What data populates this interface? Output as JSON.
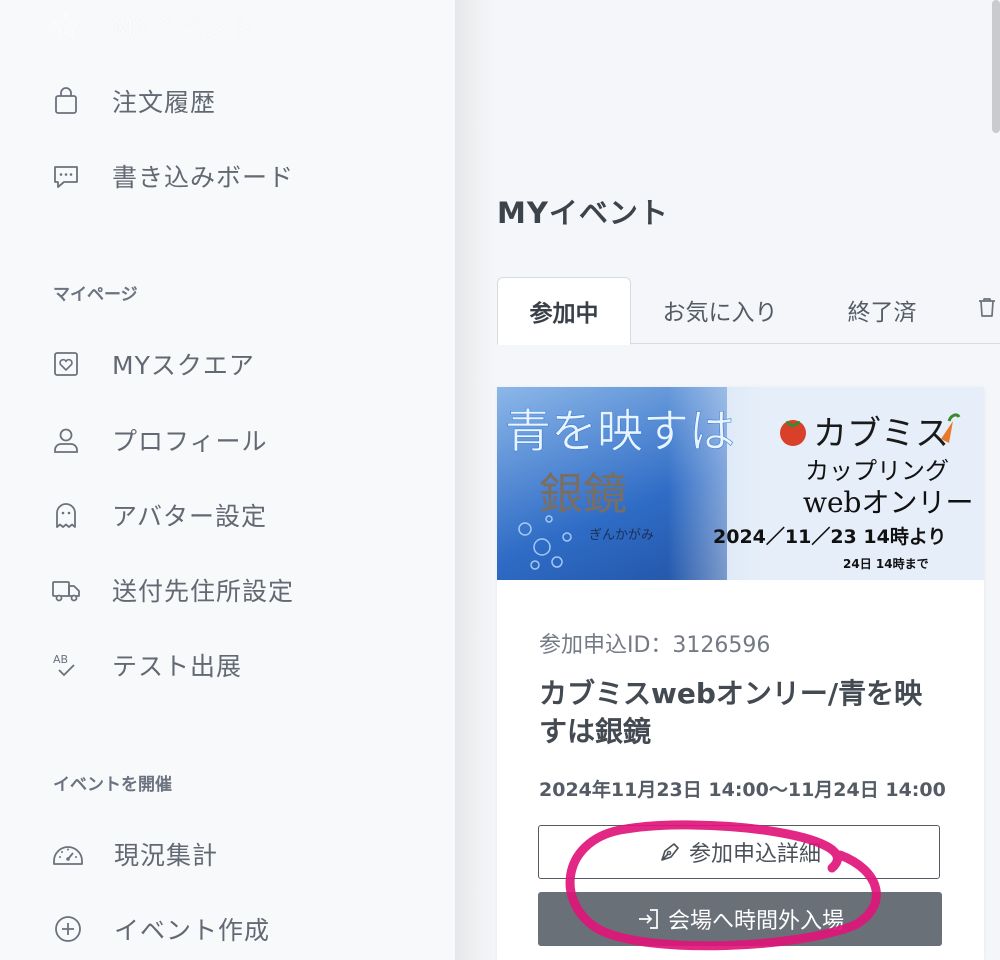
{
  "sidebar": {
    "top_item": {
      "label": "MYイベント",
      "icon": "star-icon"
    },
    "items_top": [
      {
        "label": "注文履歴",
        "icon": "shopping-bag-icon"
      },
      {
        "label": "書き込みボード",
        "icon": "chat-bubble-icon"
      }
    ],
    "section_mypage": "マイページ",
    "items_mypage": [
      {
        "label": "MYスクエア",
        "icon": "heart-square-icon"
      },
      {
        "label": "プロフィール",
        "icon": "user-icon"
      },
      {
        "label": "アバター設定",
        "icon": "ghost-icon"
      },
      {
        "label": "送付先住所設定",
        "icon": "truck-icon"
      },
      {
        "label": "テスト出展",
        "icon": "ab-check-icon"
      }
    ],
    "section_host": "イベントを開催",
    "items_host": [
      {
        "label": "現況集計",
        "icon": "speedometer-icon"
      },
      {
        "label": "イベント作成",
        "icon": "plus-circle-icon"
      }
    ]
  },
  "main": {
    "title": "MYイベント",
    "tabs": [
      {
        "label": "参加中",
        "active": true
      },
      {
        "label": "お気に入り",
        "active": false
      },
      {
        "label": "終了済",
        "active": false
      }
    ],
    "card": {
      "banner": {
        "title_line1": "青を映すは",
        "title_line2": "銀鏡",
        "ruby": "ぎんかがみ",
        "event_name": "カブミス",
        "sub1": "カップリング",
        "sub2": "webオンリー",
        "date_start": "2024／11／23  14時より",
        "date_end": "24日  14時まで"
      },
      "entry_id": "参加申込ID：3126596",
      "title": "カブミスwebオンリー/青を映すは銀鏡",
      "date": "2024年11月23日 14:00〜11月24日 14:00",
      "detail_button": "参加申込詳細",
      "enter_button": "会場へ時間外入場"
    }
  },
  "colors": {
    "annotation": "#e0157a",
    "button_dark": "#6a7078",
    "banner_blue": "#1f5fb8"
  }
}
